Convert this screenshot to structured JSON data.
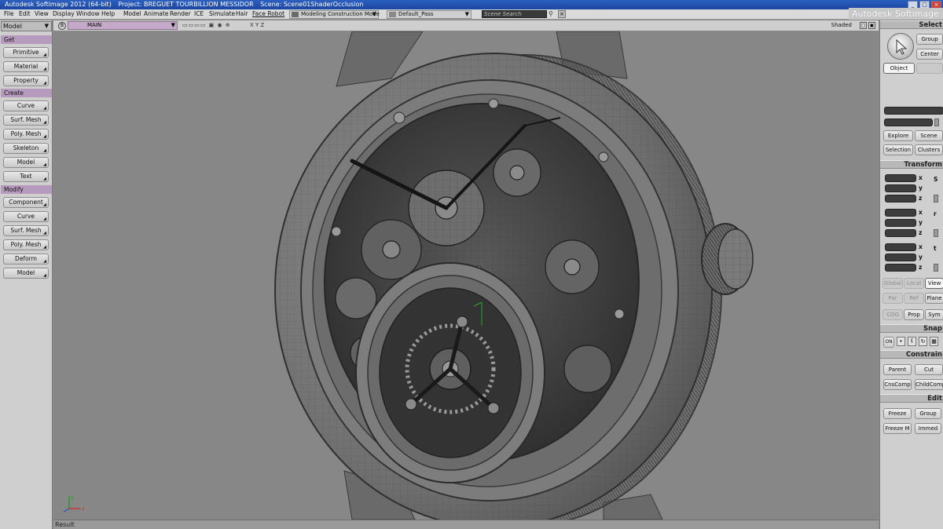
{
  "window": {
    "title": "Autodesk Softimage 2012 (64-bit)",
    "project": "Project: BREGUET TOURBILLION MESSIDOR",
    "scene": "Scene: Scene01ShaderOcclusion",
    "brand": "Autodesk Softimage"
  },
  "menubar": {
    "items": [
      "File",
      "Edit",
      "View",
      "Display",
      "Window",
      "Help",
      "Model",
      "Animate",
      "Render",
      "ICE",
      "Simulate",
      "Hair",
      "Face Robot"
    ],
    "construction_mode": "Modeling Construction Mode",
    "render_pass": "Default_Pass",
    "search_placeholder": "Scene Search"
  },
  "left_panel": {
    "mode": "Model",
    "sections": [
      {
        "label": "Get",
        "buttons": [
          "Primitive",
          "Material",
          "Property"
        ]
      },
      {
        "label": "Create",
        "buttons": [
          "Curve",
          "Surf. Mesh",
          "Poly. Mesh",
          "Skeleton",
          "Model",
          "Text"
        ]
      },
      {
        "label": "Modify",
        "buttons": [
          "Component",
          "Curve",
          "Surf. Mesh",
          "Poly. Mesh",
          "Deform",
          "Model"
        ]
      }
    ]
  },
  "viewport": {
    "letter": "B",
    "camera": "MAIN",
    "axes": "X Y Z",
    "display_mode": "Shaded",
    "status": "Result"
  },
  "right_panel": {
    "select": {
      "header": "Select",
      "group": "Group",
      "center": "Center",
      "object": "Object",
      "explore": "Explore",
      "scene": "Scene",
      "selection": "Selection",
      "clusters": "Clusters"
    },
    "transform": {
      "header": "Transform",
      "axes": [
        "x",
        "y",
        "z"
      ],
      "rows": [
        "S",
        "r",
        "t"
      ],
      "global": "Global",
      "local": "Local",
      "view": "View",
      "par": "Par",
      "ref": "Ref",
      "plane": "Plane",
      "cog": "COG",
      "prop": "Prop",
      "sym": "Sym"
    },
    "snap": {
      "header": "Snap",
      "on": "ON"
    },
    "constrain": {
      "header": "Constrain",
      "parent": "Parent",
      "cut": "Cut",
      "cnscomp": "CnsComp",
      "childcomp": "ChildComp"
    },
    "edit": {
      "header": "Edit",
      "freeze": "Freeze",
      "group": "Group",
      "freeze_m": "Freeze M",
      "immed": "Immed"
    }
  }
}
